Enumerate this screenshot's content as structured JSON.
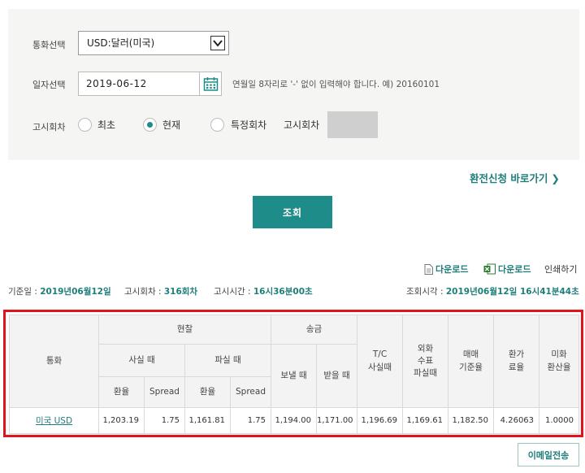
{
  "form": {
    "currency_label": "통화선택",
    "currency_value": "USD:달러(미국)",
    "date_label": "일자선택",
    "date_value": "2019-06-12",
    "date_hint": "연월일 8자리로 '-' 없이 입력해야 합니다. 예) 20160101",
    "notice_label": "고시회차",
    "radio_options": [
      "최초",
      "현재",
      "특정회차"
    ],
    "notice_number_label": "고시회차"
  },
  "shortcut_link": "환전신청 바로가기",
  "search_button": "조회",
  "tools": {
    "download_1": "다운로드",
    "download_2": "다운로드",
    "print": "인쇄하기"
  },
  "info": {
    "base_date_label": "기준일 :",
    "base_date": "2019년06월12일",
    "notice_round_label": "고시회차 :",
    "notice_round": "316회차",
    "notice_time_label": "고시시간 :",
    "notice_time": "16시36분00초",
    "query_time_label": "조회시각 :",
    "query_time": "2019년06월12일  16시41분44초"
  },
  "table": {
    "headers": {
      "currency": "통화",
      "cash": "현찰",
      "buy": "사실 때",
      "sell": "파실 때",
      "remit": "송금",
      "send": "보낼 때",
      "receive": "받을 때",
      "tc": "T/C\n사실때",
      "check": "외화\n수표\n파실때",
      "base_rate": "매매\n기준율",
      "conversion": "환가\n료율",
      "usd_rate": "미화\n환산율",
      "rate": "환율",
      "spread": "Spread"
    },
    "rows": [
      {
        "currency": "미국 USD",
        "cash_buy_rate": "1,203.19",
        "cash_buy_spread": "1.75",
        "cash_sell_rate": "1,161.81",
        "cash_sell_spread": "1.75",
        "send": "1,194.00",
        "receive": "1,171.00",
        "tc": "1,196.69",
        "check": "1,169.61",
        "base_rate": "1,182.50",
        "conversion": "4.26063",
        "usd_rate": "1.0000"
      }
    ]
  },
  "email_button": "이메일전송"
}
